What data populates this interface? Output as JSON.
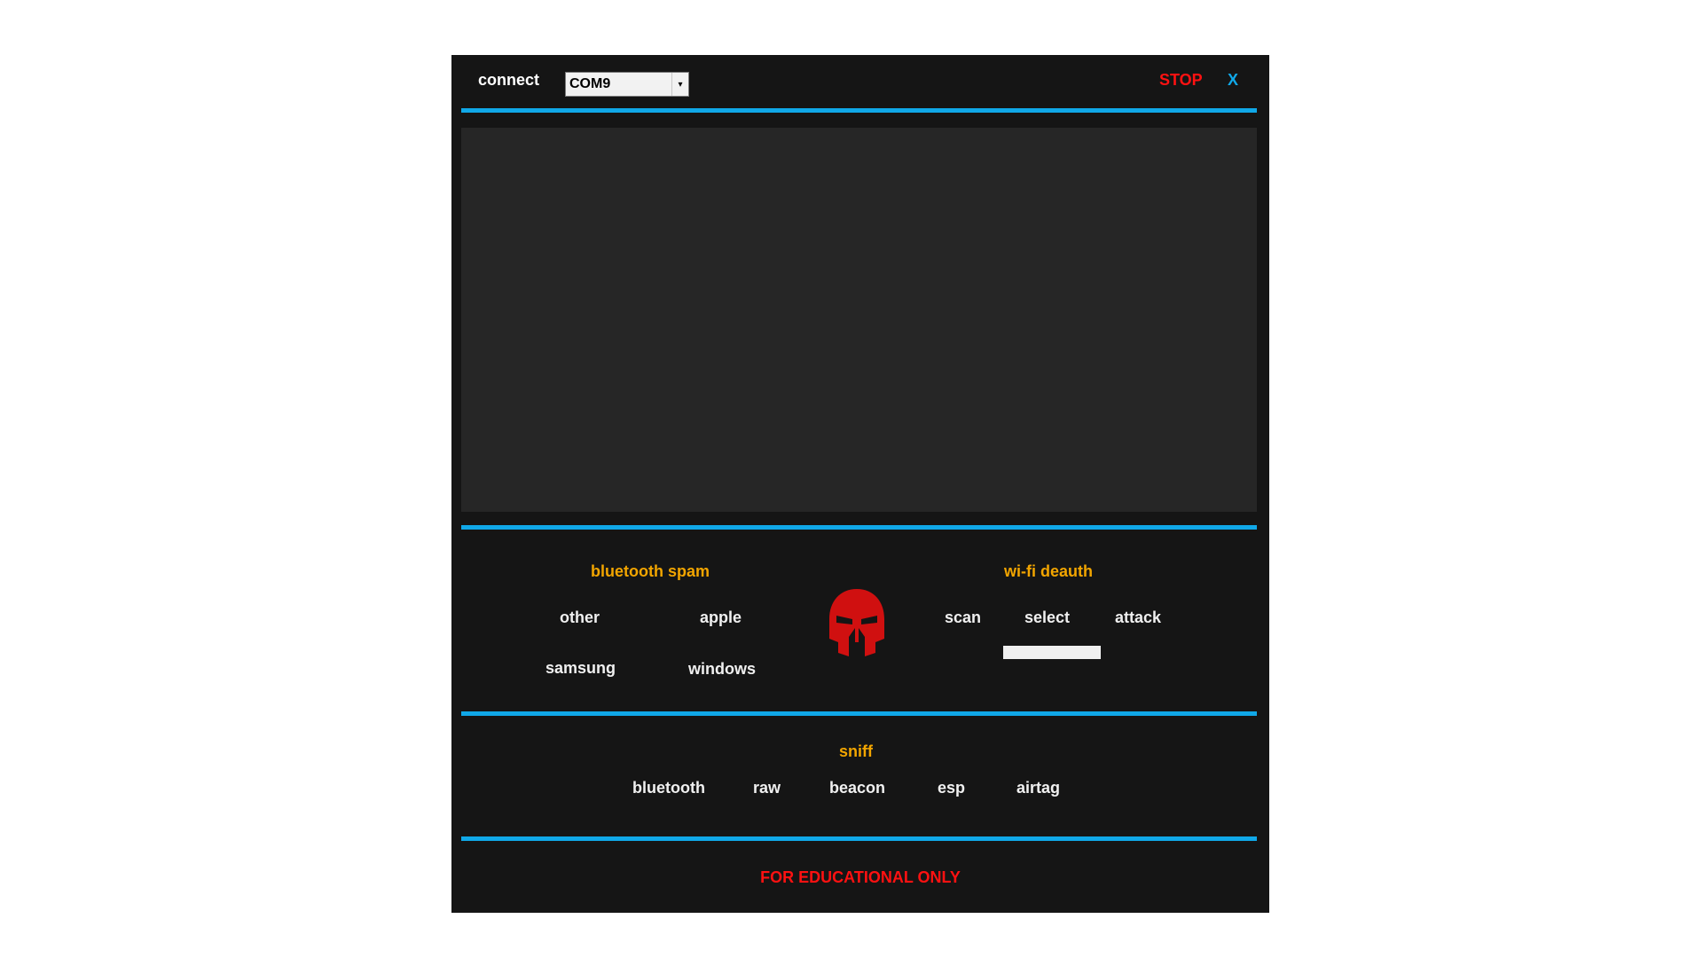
{
  "topbar": {
    "connect_label": "connect",
    "port_value": "COM9",
    "stop_label": "STOP",
    "close_label": "X"
  },
  "bluetooth_spam": {
    "title": "bluetooth spam",
    "options": [
      "other",
      "apple",
      "samsung",
      "windows"
    ]
  },
  "logo": {
    "icon": "spartan-helmet-icon",
    "color": "#d01010"
  },
  "wifi_deauth": {
    "title": "wi-fi deauth",
    "options": [
      "scan",
      "select",
      "attack"
    ]
  },
  "sniff": {
    "title": "sniff",
    "options": [
      "bluetooth",
      "raw",
      "beacon",
      "esp",
      "airtag"
    ]
  },
  "footer": {
    "text": "FOR EDUCATIONAL ONLY"
  },
  "colors": {
    "accent": "#10a8e8",
    "section_title": "#f2a500",
    "warning": "#ff1111",
    "background": "#151515",
    "output_background": "#262626"
  }
}
